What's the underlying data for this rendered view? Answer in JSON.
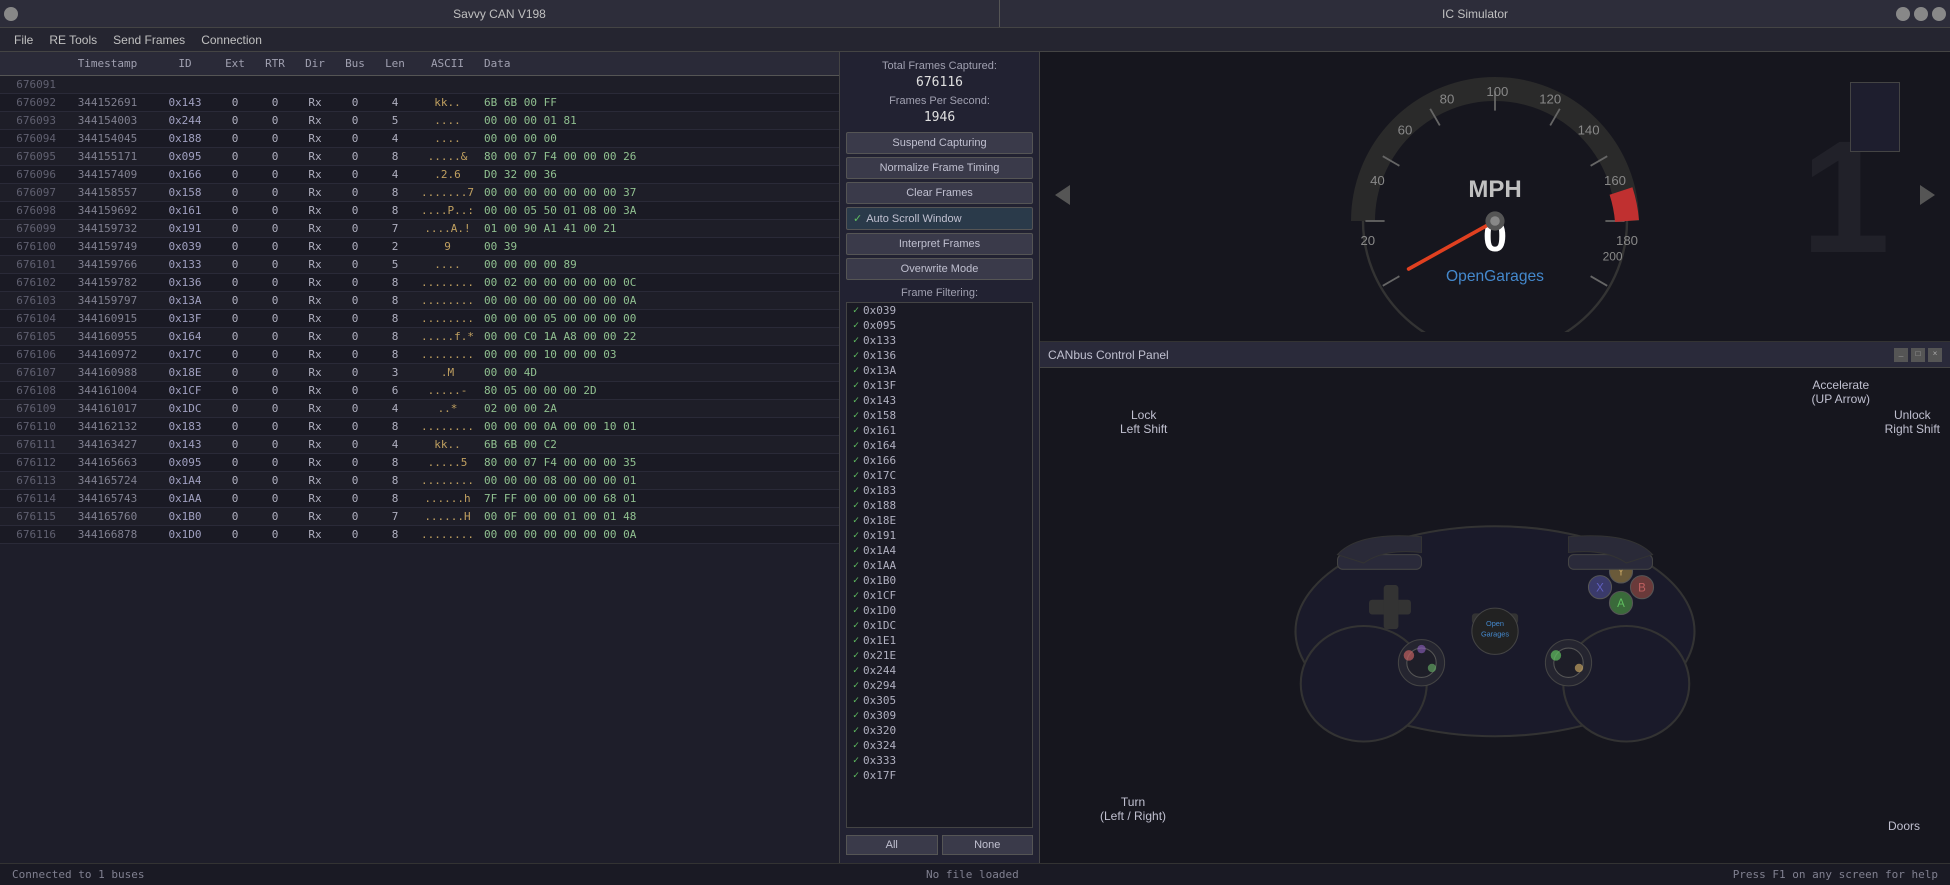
{
  "titleBar": {
    "title": "Savvy CAN V198",
    "buttons": [
      "min",
      "max",
      "close"
    ]
  },
  "icSimulator": {
    "title": "IC Simulator"
  },
  "menuBar": {
    "items": [
      "File",
      "RE Tools",
      "Send Frames",
      "Connection"
    ]
  },
  "table": {
    "headers": [
      "",
      "Timestamp",
      "ID",
      "Ext",
      "RTR",
      "Dir",
      "Bus",
      "Len",
      "ASCII",
      "Data"
    ],
    "rows": [
      {
        "rowNum": "676091",
        "ts": "",
        "id": "",
        "ext": "",
        "rtr": "",
        "dir": "",
        "bus": "",
        "len": "",
        "ascii": "",
        "data": ""
      },
      {
        "rowNum": "676092",
        "ts": "344152691",
        "id": "0x143",
        "ext": "0",
        "rtr": "0",
        "dir": "Rx",
        "bus": "0",
        "len": "4",
        "ascii": "kk..",
        "data": "6B 6B 00 FF"
      },
      {
        "rowNum": "676093",
        "ts": "344154003",
        "id": "0x244",
        "ext": "0",
        "rtr": "0",
        "dir": "Rx",
        "bus": "0",
        "len": "5",
        "ascii": "....",
        "data": "00 00 00 01 81"
      },
      {
        "rowNum": "676094",
        "ts": "344154045",
        "id": "0x188",
        "ext": "0",
        "rtr": "0",
        "dir": "Rx",
        "bus": "0",
        "len": "4",
        "ascii": "....",
        "data": "00 00 00 00"
      },
      {
        "rowNum": "676095",
        "ts": "344155171",
        "id": "0x095",
        "ext": "0",
        "rtr": "0",
        "dir": "Rx",
        "bus": "0",
        "len": "8",
        "ascii": ".....&",
        "data": "80 00 07 F4 00 00 00 26"
      },
      {
        "rowNum": "676096",
        "ts": "344157409",
        "id": "0x166",
        "ext": "0",
        "rtr": "0",
        "dir": "Rx",
        "bus": "0",
        "len": "4",
        "ascii": ".2.6",
        "data": "D0 32 00 36"
      },
      {
        "rowNum": "676097",
        "ts": "344158557",
        "id": "0x158",
        "ext": "0",
        "rtr": "0",
        "dir": "Rx",
        "bus": "0",
        "len": "8",
        "ascii": ".......7",
        "data": "00 00 00 00 00 00 00 37"
      },
      {
        "rowNum": "676098",
        "ts": "344159692",
        "id": "0x161",
        "ext": "0",
        "rtr": "0",
        "dir": "Rx",
        "bus": "0",
        "len": "8",
        "ascii": "....P..:",
        "data": "00 00 05 50 01 08 00 3A"
      },
      {
        "rowNum": "676099",
        "ts": "344159732",
        "id": "0x191",
        "ext": "0",
        "rtr": "0",
        "dir": "Rx",
        "bus": "0",
        "len": "7",
        "ascii": "....A.!",
        "data": "01 00 90 A1 41 00 21"
      },
      {
        "rowNum": "676100",
        "ts": "344159749",
        "id": "0x039",
        "ext": "0",
        "rtr": "0",
        "dir": "Rx",
        "bus": "0",
        "len": "2",
        "ascii": "9",
        "data": "00 39"
      },
      {
        "rowNum": "676101",
        "ts": "344159766",
        "id": "0x133",
        "ext": "0",
        "rtr": "0",
        "dir": "Rx",
        "bus": "0",
        "len": "5",
        "ascii": "....",
        "data": "00 00 00 00 89"
      },
      {
        "rowNum": "676102",
        "ts": "344159782",
        "id": "0x136",
        "ext": "0",
        "rtr": "0",
        "dir": "Rx",
        "bus": "0",
        "len": "8",
        "ascii": "........",
        "data": "00 02 00 00 00 00 00 0C"
      },
      {
        "rowNum": "676103",
        "ts": "344159797",
        "id": "0x13A",
        "ext": "0",
        "rtr": "0",
        "dir": "Rx",
        "bus": "0",
        "len": "8",
        "ascii": "........",
        "data": "00 00 00 00 00 00 00 0A"
      },
      {
        "rowNum": "676104",
        "ts": "344160915",
        "id": "0x13F",
        "ext": "0",
        "rtr": "0",
        "dir": "Rx",
        "bus": "0",
        "len": "8",
        "ascii": "........",
        "data": "00 00 00 05 00 00 00 00"
      },
      {
        "rowNum": "676105",
        "ts": "344160955",
        "id": "0x164",
        "ext": "0",
        "rtr": "0",
        "dir": "Rx",
        "bus": "0",
        "len": "8",
        "ascii": ".....f.*",
        "data": "00 00 C0 1A A8 00 00 22"
      },
      {
        "rowNum": "676106",
        "ts": "344160972",
        "id": "0x17C",
        "ext": "0",
        "rtr": "0",
        "dir": "Rx",
        "bus": "0",
        "len": "8",
        "ascii": "........",
        "data": "00 00 00 10 00 00 03"
      },
      {
        "rowNum": "676107",
        "ts": "344160988",
        "id": "0x18E",
        "ext": "0",
        "rtr": "0",
        "dir": "Rx",
        "bus": "0",
        "len": "3",
        "ascii": ".M",
        "data": "00 00 4D"
      },
      {
        "rowNum": "676108",
        "ts": "344161004",
        "id": "0x1CF",
        "ext": "0",
        "rtr": "0",
        "dir": "Rx",
        "bus": "0",
        "len": "6",
        "ascii": ".....-",
        "data": "80 05 00 00 00 2D"
      },
      {
        "rowNum": "676109",
        "ts": "344161017",
        "id": "0x1DC",
        "ext": "0",
        "rtr": "0",
        "dir": "Rx",
        "bus": "0",
        "len": "4",
        "ascii": "..*",
        "data": "02 00 00 2A"
      },
      {
        "rowNum": "676110",
        "ts": "344162132",
        "id": "0x183",
        "ext": "0",
        "rtr": "0",
        "dir": "Rx",
        "bus": "0",
        "len": "8",
        "ascii": "........",
        "data": "00 00 00 0A 00 00 10 01"
      },
      {
        "rowNum": "676111",
        "ts": "344163427",
        "id": "0x143",
        "ext": "0",
        "rtr": "0",
        "dir": "Rx",
        "bus": "0",
        "len": "4",
        "ascii": "kk..",
        "data": "6B 6B 00 C2"
      },
      {
        "rowNum": "676112",
        "ts": "344165663",
        "id": "0x095",
        "ext": "0",
        "rtr": "0",
        "dir": "Rx",
        "bus": "0",
        "len": "8",
        "ascii": ".....5",
        "data": "80 00 07 F4 00 00 00 35"
      },
      {
        "rowNum": "676113",
        "ts": "344165724",
        "id": "0x1A4",
        "ext": "0",
        "rtr": "0",
        "dir": "Rx",
        "bus": "0",
        "len": "8",
        "ascii": "........",
        "data": "00 00 00 08 00 00 00 01"
      },
      {
        "rowNum": "676114",
        "ts": "344165743",
        "id": "0x1AA",
        "ext": "0",
        "rtr": "0",
        "dir": "Rx",
        "bus": "0",
        "len": "8",
        "ascii": "......h",
        "data": "7F FF 00 00 00 00 68 01"
      },
      {
        "rowNum": "676115",
        "ts": "344165760",
        "id": "0x1B0",
        "ext": "0",
        "rtr": "0",
        "dir": "Rx",
        "bus": "0",
        "len": "7",
        "ascii": "......H",
        "data": "00 0F 00 00 01 00 01 48"
      },
      {
        "rowNum": "676116",
        "ts": "344166878",
        "id": "0x1D0",
        "ext": "0",
        "rtr": "0",
        "dir": "Rx",
        "bus": "0",
        "len": "8",
        "ascii": "........",
        "data": "00 00 00 00 00 00 00 0A"
      }
    ]
  },
  "rightPanel": {
    "totalFramesLabel": "Total Frames Captured:",
    "totalFrames": "676116",
    "fpsLabel": "Frames Per Second:",
    "fps": "1946",
    "buttons": {
      "suspendCapturing": "Suspend Capturing",
      "normalizeFrameTiming": "Normalize Frame Timing",
      "clearFrames": "Clear Frames",
      "autoScrollWindow": "Auto Scroll Window",
      "interpretFrames": "Interpret Frames",
      "overwriteMode": "Overwrite Mode"
    },
    "frameFilteringLabel": "Frame Filtering:",
    "filterItems": [
      "0x039",
      "0x095",
      "0x133",
      "0x136",
      "0x13A",
      "0x13F",
      "0x143",
      "0x158",
      "0x161",
      "0x164",
      "0x166",
      "0x17C",
      "0x183",
      "0x188",
      "0x18E",
      "0x191",
      "0x1A4",
      "0x1AA",
      "0x1B0",
      "0x1CF",
      "0x1D0",
      "0x1DC",
      "0x1E1",
      "0x21E",
      "0x244",
      "0x294",
      "0x305",
      "0x309",
      "0x320",
      "0x324",
      "0x333",
      "0x17F"
    ],
    "filterButtons": {
      "all": "All",
      "none": "None"
    }
  },
  "icSimulatorPanel": {
    "title": "IC Simulator",
    "gauge": {
      "speed": 0,
      "unit": "MPH",
      "brand": "OpenGarages",
      "maxSpeed": 260,
      "minSpeed": 0
    }
  },
  "canbusPanel": {
    "title": "CANbus Control Panel",
    "actions": {
      "accelerate": "Accelerate\n(UP Arrow)",
      "lock": "Lock\nLeft Shift",
      "unlock": "Unlock\nRight Shift",
      "turn": "Turn\n(Left / Right)",
      "doors": "Doors"
    },
    "brand": "OpenGarages"
  },
  "statusBar": {
    "connection": "Connected to 1 buses",
    "file": "No file loaded",
    "help": "Press F1 on any screen for help"
  },
  "watermark": "1"
}
